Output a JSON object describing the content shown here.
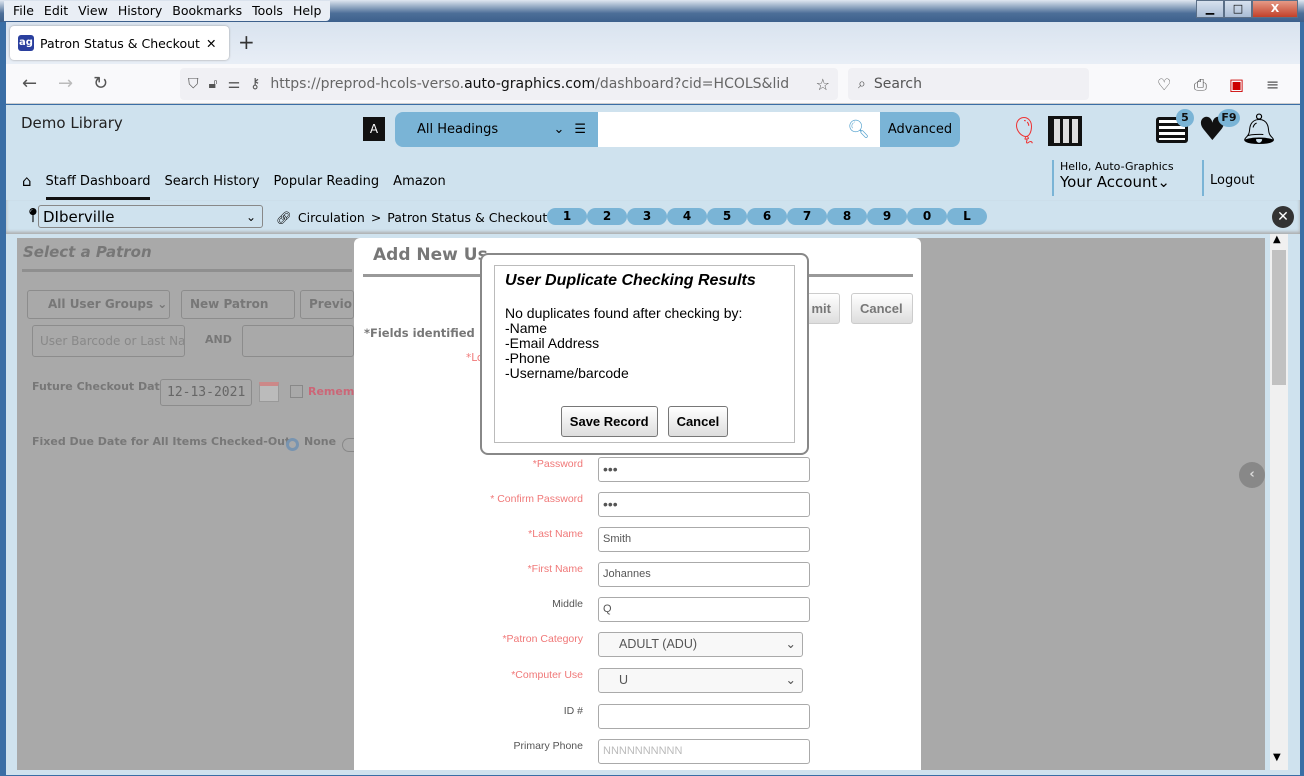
{
  "browser": {
    "menu": [
      "File",
      "Edit",
      "View",
      "History",
      "Bookmarks",
      "Tools",
      "Help"
    ],
    "tab_title": "Patron Status & Checkout | HCOLS",
    "url_prefix": "https://preprod-hcols-verso.",
    "url_domain": "auto-graphics.com",
    "url_suffix": "/dashboard?cid=HCOLS&lid=HCOLS",
    "search_placeholder": "Search"
  },
  "header": {
    "library": "Demo Library",
    "heading_select": "All Headings",
    "advanced": "Advanced",
    "list_badge": "5",
    "favorites_badge": "F9"
  },
  "nav": {
    "items": [
      "Staff Dashboard",
      "Search History",
      "Popular Reading",
      "Amazon"
    ],
    "greeting": "Hello, Auto-Graphics",
    "account": "Your Account",
    "logout": "Logout"
  },
  "subbar": {
    "branch": "DIberville",
    "crumb_parent": "Circulation",
    "crumb_sep": ">",
    "crumb_current": "Patron Status & Checkout",
    "letters": [
      "1",
      "2",
      "3",
      "4",
      "5",
      "6",
      "7",
      "8",
      "9",
      "0",
      "L"
    ]
  },
  "background": {
    "title": "Select a Patron",
    "user_groups": "All User Groups",
    "new_patron": "New Patron",
    "previous": "Previo",
    "barcode_placeholder": "User Barcode or Last Na",
    "and": "AND",
    "future_label": "Future Checkout Date:",
    "future_date": "12-13-2021",
    "remember": "Rememb",
    "fixed_due_label": "Fixed Due Date for All Items Checked-Out:",
    "none": "None"
  },
  "modal": {
    "title": "Add New Us",
    "fields_note": "*Fields identified",
    "submit": "mit",
    "cancel": "Cancel",
    "location_label": "*Lo",
    "fields": [
      {
        "label": "*Password",
        "value": "•••",
        "required": true
      },
      {
        "label": "* Confirm Password",
        "value": "•••",
        "required": true
      },
      {
        "label": "*Last Name",
        "value": "Smith",
        "required": true
      },
      {
        "label": "*First Name",
        "value": "Johannes",
        "required": true
      },
      {
        "label": "Middle",
        "value": "Q",
        "required": false
      },
      {
        "label": "*Patron Category",
        "value": "ADULT (ADU)",
        "required": true
      },
      {
        "label": "*Computer Use",
        "value": "U",
        "required": true
      },
      {
        "label": "ID #",
        "value": "",
        "required": false
      },
      {
        "label": "Primary Phone",
        "value": "",
        "placeholder": "NNNNNNNNNN",
        "required": false
      }
    ]
  },
  "dialog": {
    "title": "User Duplicate Checking Results",
    "message": "No duplicates found after checking by:",
    "criteria": [
      "-Name",
      "-Email Address",
      "-Phone",
      "-Username/barcode"
    ],
    "save": "Save Record",
    "cancel": "Cancel"
  }
}
